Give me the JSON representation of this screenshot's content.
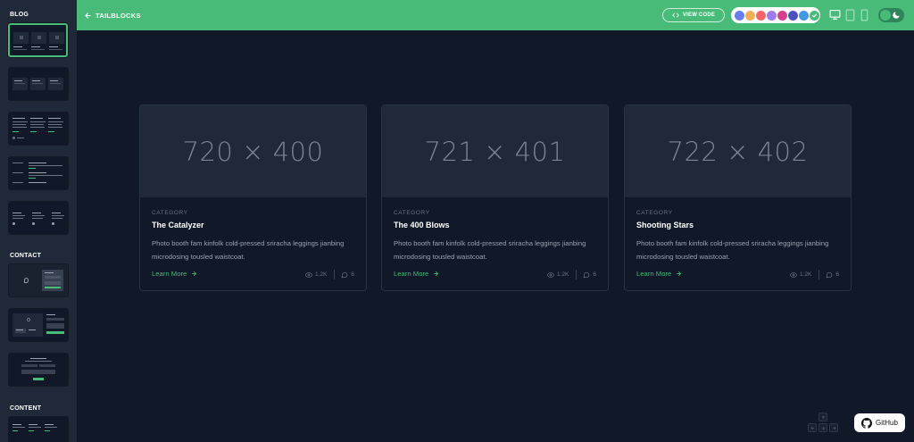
{
  "header": {
    "back_label": "TAILBLOCKS",
    "view_code_label": "VIEW CODE",
    "colors": [
      "#667eea",
      "#f6ad55",
      "#f56565",
      "#9f7aea",
      "#d53f8c",
      "#4c51bf",
      "#4299e1",
      "#48bb78"
    ],
    "selected_color": "#48bb78"
  },
  "sidebar": {
    "sections": [
      {
        "title": "BLOG"
      },
      {
        "title": "CONTACT"
      },
      {
        "title": "CONTENT"
      }
    ]
  },
  "cards": [
    {
      "image_text": "720 × 400",
      "category": "CATEGORY",
      "title": "The Catalyzer",
      "description": "Photo booth fam kinfolk cold-pressed sriracha leggings jianbing microdosing tousled waistcoat.",
      "link": "Learn More",
      "views": "1.2K",
      "comments": "6"
    },
    {
      "image_text": "721 × 401",
      "category": "CATEGORY",
      "title": "The 400 Blows",
      "description": "Photo booth fam kinfolk cold-pressed sriracha leggings jianbing microdosing tousled waistcoat.",
      "link": "Learn More",
      "views": "1.2K",
      "comments": "6"
    },
    {
      "image_text": "722 × 402",
      "category": "CATEGORY",
      "title": "Shooting Stars",
      "description": "Photo booth fam kinfolk cold-pressed sriracha leggings jianbing microdosing tousled waistcoat.",
      "link": "Learn More",
      "views": "1.2K",
      "comments": "6"
    }
  ],
  "github_label": "GitHub"
}
